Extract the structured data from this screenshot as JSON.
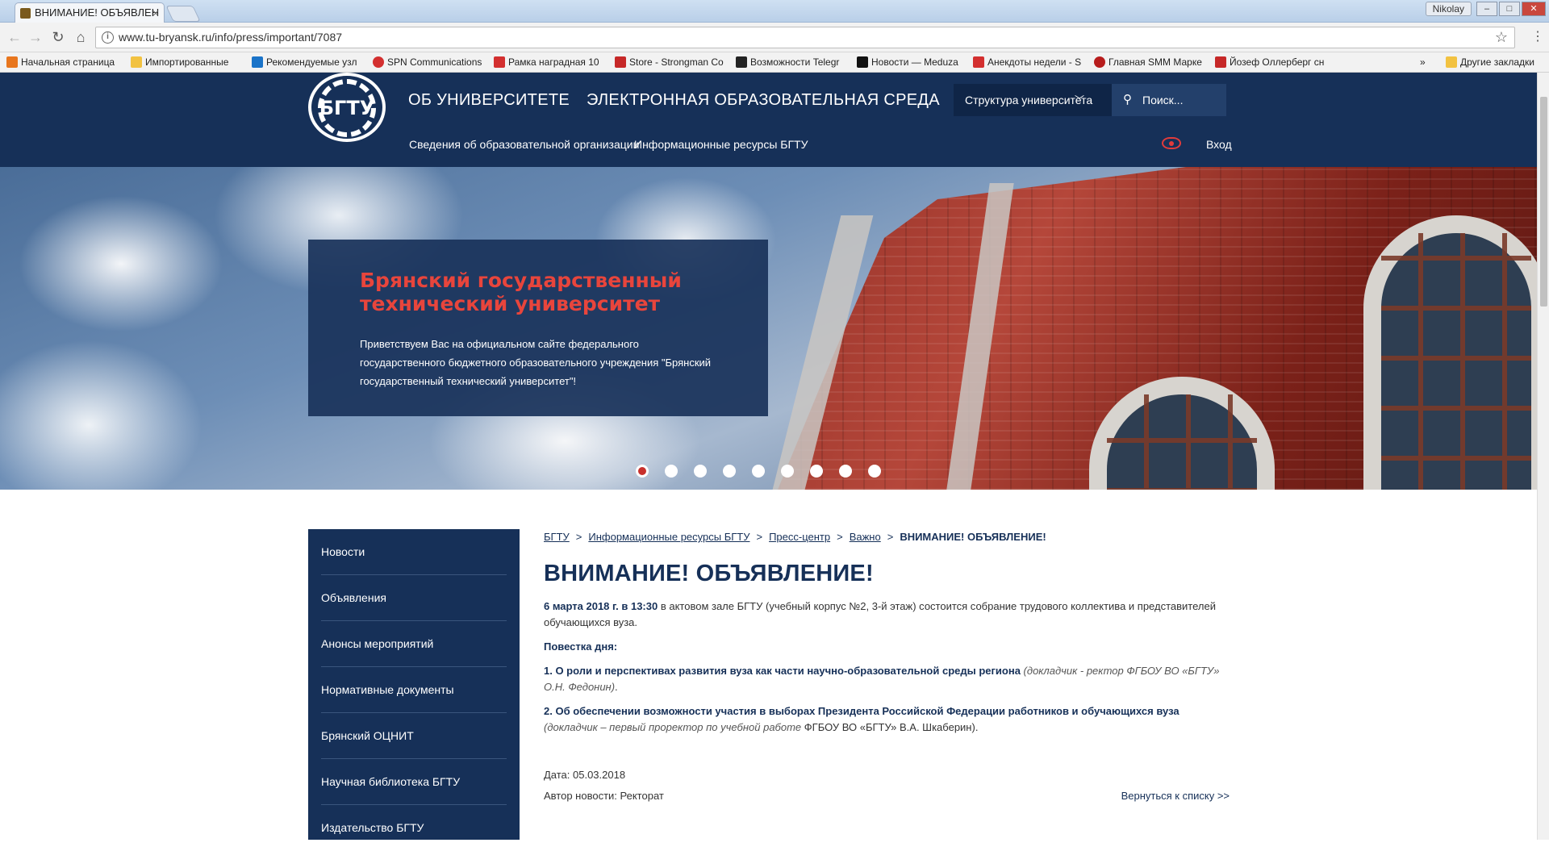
{
  "browser": {
    "tab_title": "ВНИМАНИЕ! ОБЪЯВЛЕН",
    "user": "Nikolay",
    "url": "www.tu-bryansk.ru/info/press/important/7087",
    "bookmarks": [
      {
        "label": "Начальная страница",
        "color": "#e8761e"
      },
      {
        "label": "Импортированные",
        "color": "#f2c241"
      },
      {
        "label": "Рекомендуемые узл",
        "color": "#1a73c8"
      },
      {
        "label": "SPN Communications",
        "color": "#d32f2f"
      },
      {
        "label": "Рамка наградная 10",
        "color": "#d32f2f"
      },
      {
        "label": "Store - Strongman Co",
        "color": "#c62828"
      },
      {
        "label": "Возможности Telegr",
        "color": "#222222"
      },
      {
        "label": "Новости — Meduza",
        "color": "#111111"
      },
      {
        "label": "Анекдоты недели - S",
        "color": "#d32f2f"
      },
      {
        "label": "Главная SMM Марке",
        "color": "#b71c1c"
      },
      {
        "label": "Йозеф Оллерберг сн",
        "color": "#c62828"
      }
    ],
    "other_bookmarks": "Другие закладки",
    "overflow": "»"
  },
  "header": {
    "logo_text": "БГТУ",
    "nav": [
      "ОБ УНИВЕРСИТЕТЕ",
      "ЭЛЕКТРОННАЯ ОБРАЗОВАТЕЛЬНАЯ СРЕДА"
    ],
    "structure": "Структура университета",
    "search_placeholder": "Поиск...",
    "subnav": [
      "Сведения об образовательной организации",
      "Информационные ресурсы БГТУ"
    ],
    "login": "Вход"
  },
  "hero": {
    "title": "Брянский государственный технический университет",
    "text": "Приветствуем Вас на официальном сайте федерального государственного бюджетного образовательного учреждения \"Брянский государственный технический университет\"!",
    "slides": 9,
    "active_slide": 1
  },
  "sidebar": {
    "items": [
      "Новости",
      "Объявления",
      "Анонсы мероприятий",
      "Нормативные документы",
      "Брянский ОЦНИТ",
      "Научная библиотека БГТУ",
      "Издательство БГТУ"
    ]
  },
  "content": {
    "breadcrumb": [
      "БГТУ",
      "Информационные ресурсы БГТУ",
      "Пресс-центр",
      "Важно"
    ],
    "breadcrumb_current": "ВНИМАНИЕ! ОБЪЯВЛЕНИЕ!",
    "breadcrumb_sep": ">",
    "title": "ВНИМАНИЕ! ОБЪЯВЛЕНИЕ!",
    "p1_bold": "6 марта 2018 г. в 13:30",
    "p1_text": " в актовом зале БГТУ (учебный корпус №2, 3-й этаж) состоится собрание трудового коллектива и представителей обучающихся вуза.",
    "agenda_label": "Повестка дня:",
    "item1_bold": "1. О роли и перспективах развития вуза как части научно-образовательной среды региона",
    "item1_italic": " (докладчик - ректор ФГБОУ ВО «БГТУ» О.Н. Федонин)",
    "item1_end": ".",
    "item2_bold": "2. Об обеспечении возможности участия в выборах Президента Российской Федерации работников и обучающихся вуза",
    "item2_italic": " (докладчик – первый проректор по учебной работе",
    "item2_end": " ФГБОУ ВО «БГТУ» В.А. Шкаберин).",
    "date": "Дата: 05.03.2018",
    "author": "Автор новости: Ректорат",
    "back": "Вернуться к списку >>"
  }
}
